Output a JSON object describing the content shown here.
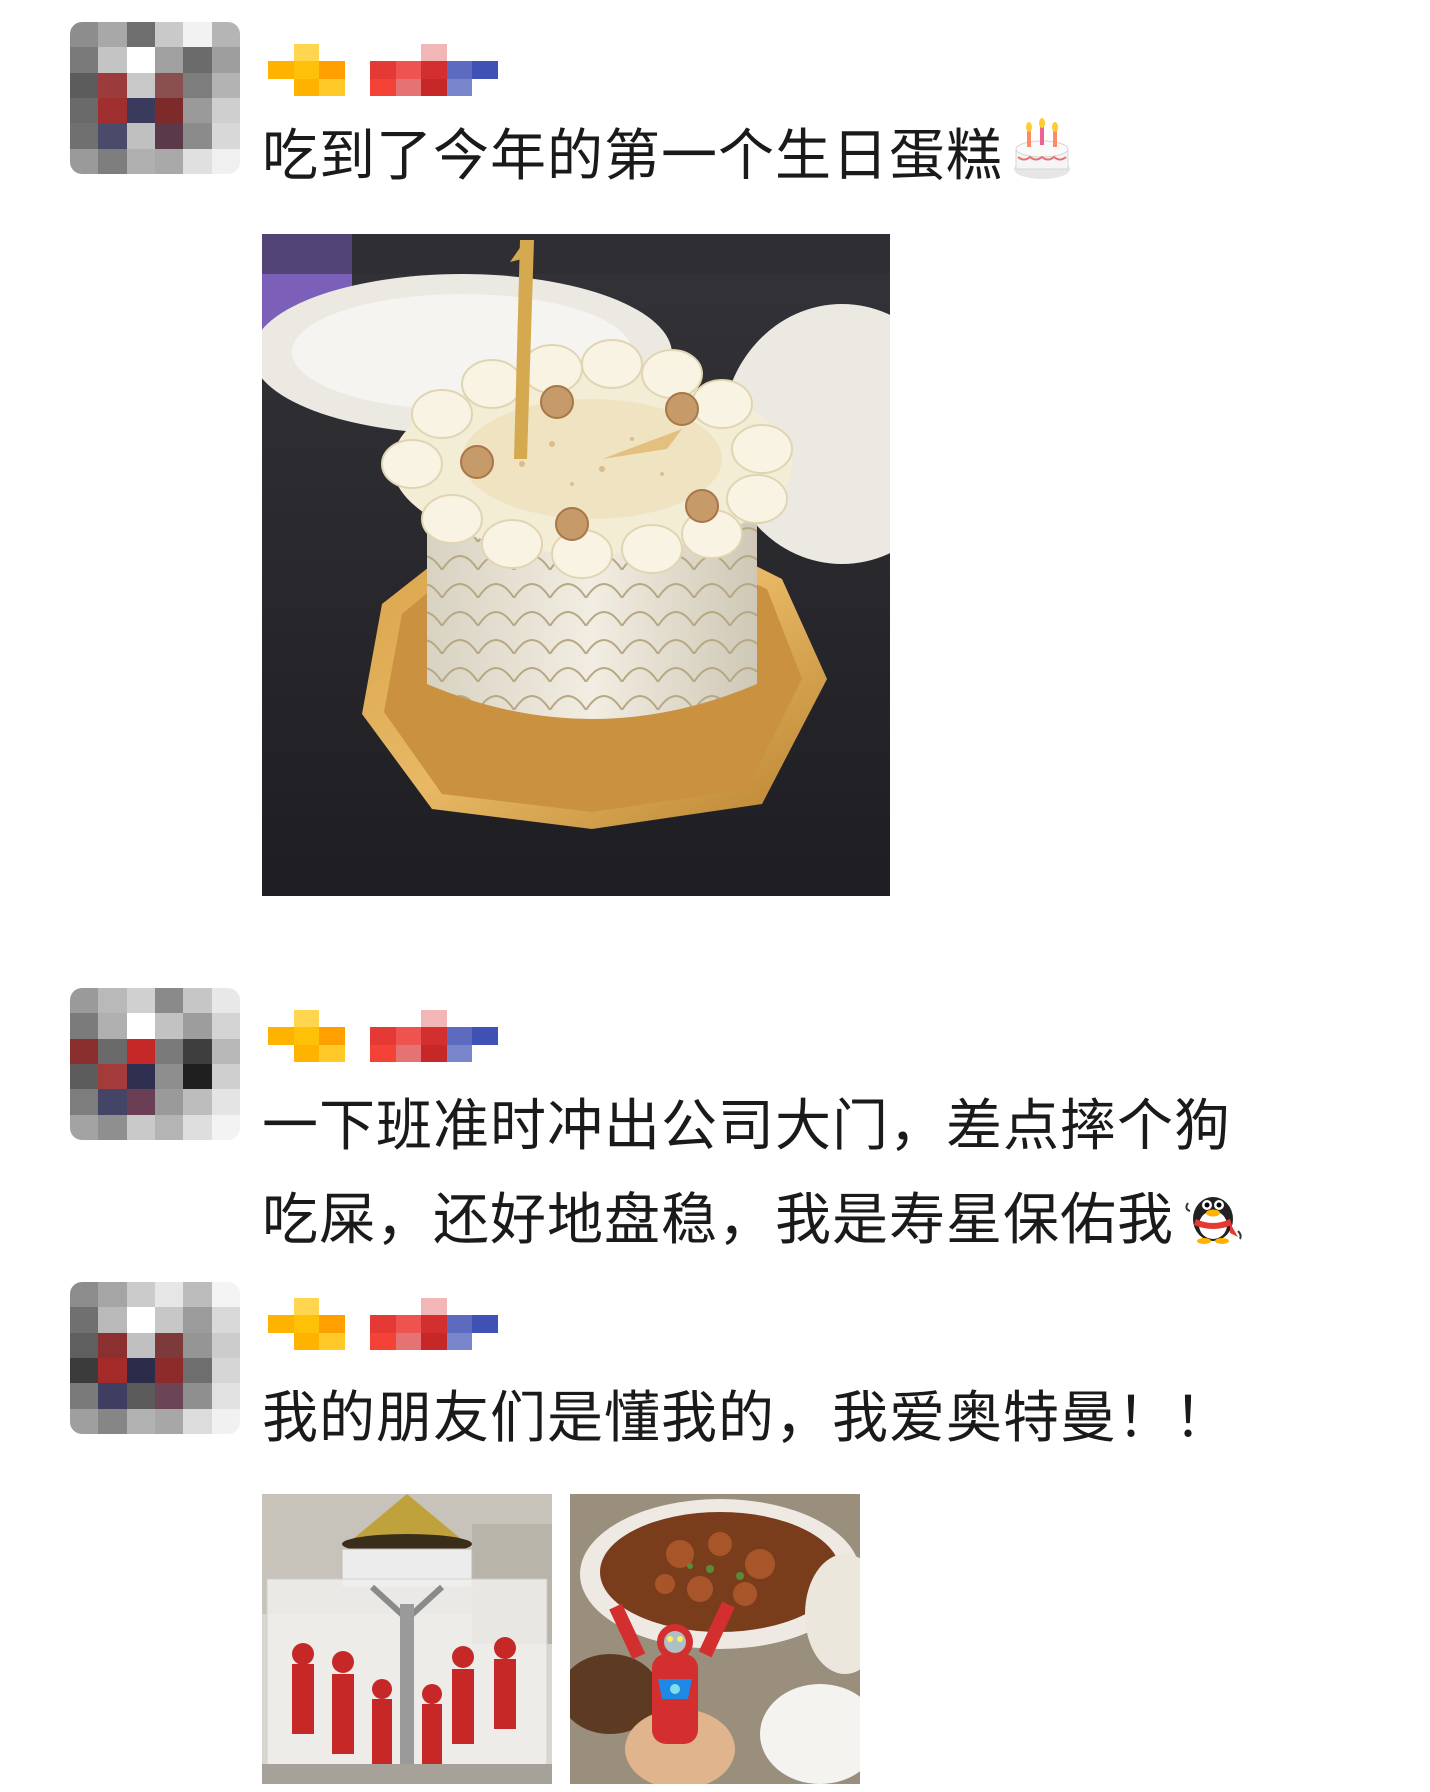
{
  "posts": [
    {
      "text_lines": [
        "吃到了今年的第一个生日蛋糕"
      ],
      "emoji": "birthday-cake",
      "photo_count": 1
    },
    {
      "text_lines": [
        "一下班准时冲出公司大门，差点摔个狗",
        "吃屎，还好地盘稳，我是寿星保佑我"
      ],
      "emoji": "qq-penguin",
      "photo_count": 0
    },
    {
      "text_lines": [
        "我的朋友们是懂我的，我爱奥特曼！！"
      ],
      "emoji": "",
      "photo_count": 2
    }
  ],
  "colors": {
    "background": "#ffffff",
    "text": "#1a1a1a"
  }
}
